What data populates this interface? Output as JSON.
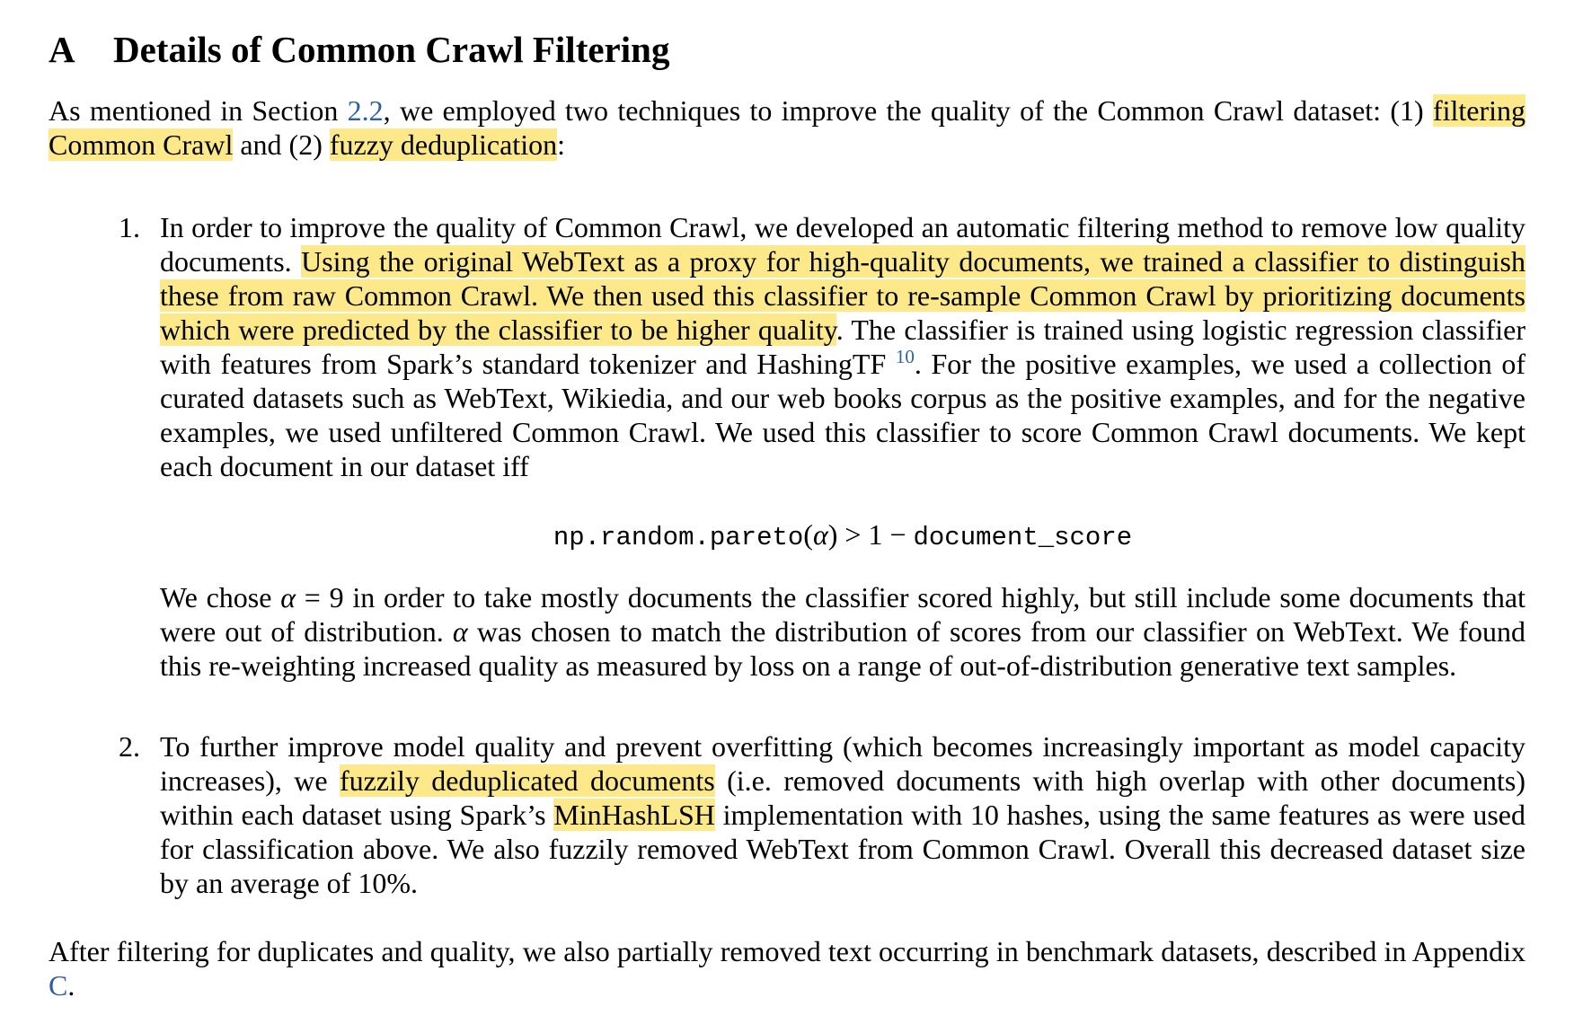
{
  "heading": {
    "number": "A",
    "title": "Details of Common Crawl Filtering"
  },
  "intro": {
    "t1": "As mentioned in Section ",
    "ref": "2.2",
    "t2": ", we employed two techniques to improve the quality of the Common Crawl dataset: (1) ",
    "hl1": "filtering Common Crawl",
    "t3": " and (2) ",
    "hl2": "fuzzy deduplication",
    "t4": ":"
  },
  "item1": {
    "number": "1.",
    "t1": "In order to improve the quality of Common Crawl, we developed an automatic filtering method to remove low quality documents. ",
    "hl": "Using the original WebText as a proxy for high-quality documents, we trained a classifier to distinguish these from raw Common Crawl. We then used this classifier to re-sample Common Crawl by prioritizing documents which were predicted by the classifier to be higher quality",
    "t2": ". The classifier is trained using logistic regression classifier with features from Spark’s standard tokenizer and HashingTF ",
    "footnote": "10",
    "t3": ". For the positive examples, we used a collection of curated datasets such as WebText, Wikiedia, and our web books corpus as the positive examples, and for the negative examples, we used unfiltered Common Crawl. We used this classifier to score Common Crawl documents. We kept each document in our dataset iff",
    "equation": {
      "func": "np.random.pareto",
      "open": "(",
      "alpha": "α",
      "close": ")",
      "gt": " > 1 − ",
      "score": "document_score"
    },
    "p2": {
      "t1": "We chose ",
      "alpha": "α",
      "eq": " = 9",
      "t2": " in order to take mostly documents the classifier scored highly, but still include some documents that were out of distribution. ",
      "alpha2": "α",
      "t3": " was chosen to match the distribution of scores from our classifier on WebText. We found this re-weighting increased quality as measured by loss on a range of out-of-distribution generative text samples."
    }
  },
  "item2": {
    "number": "2.",
    "t1": "To further improve model quality and prevent overfitting (which becomes increasingly important as model capacity increases), we ",
    "hl1": "fuzzily deduplicated documents",
    "t2": " (i.e. removed documents with high overlap with other documents) within each dataset using Spark’s ",
    "hl2": "MinHashLSH",
    "t3": " implementation with 10 hashes, using the same features as were used for classification above. We also fuzzily removed WebText from Common Crawl. Overall this decreased dataset size by an average of 10%."
  },
  "outro": {
    "t1": "After filtering for duplicates and quality, we also partially removed text occurring in benchmark datasets, described in Appendix ",
    "ref": "C",
    "t2": "."
  },
  "colors": {
    "highlight": "#fde98a",
    "link": "#2d5fa8"
  }
}
